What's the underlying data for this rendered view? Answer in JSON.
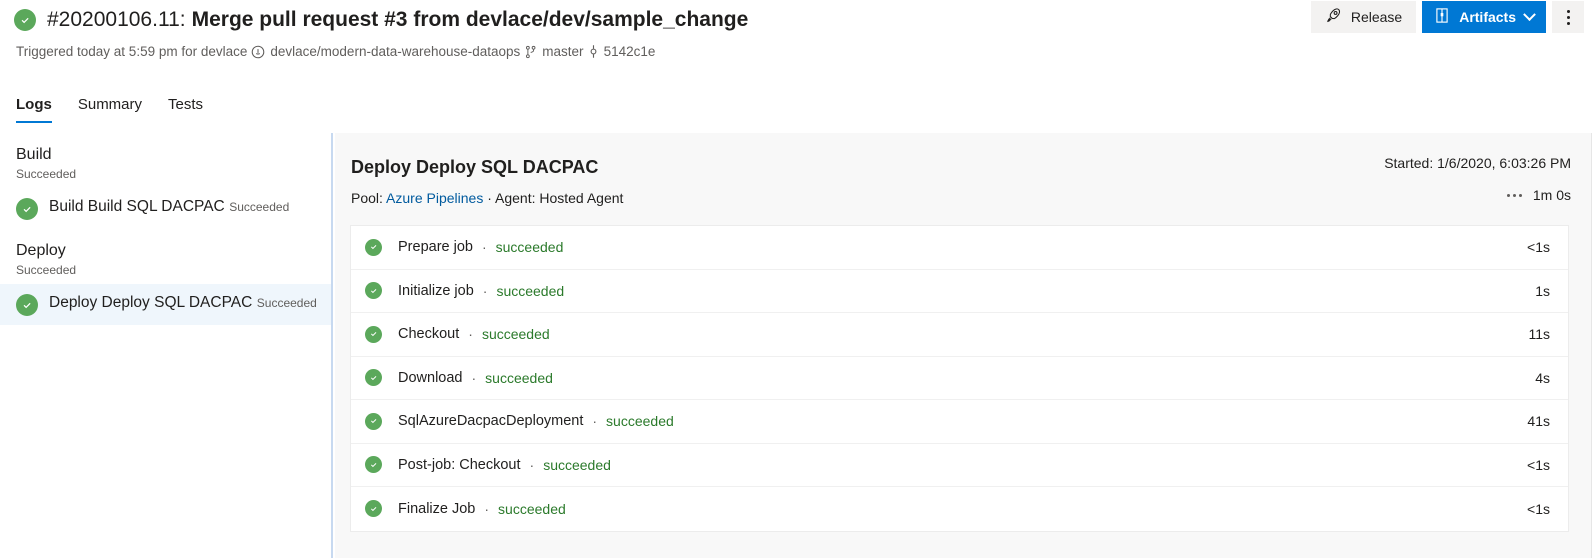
{
  "header": {
    "status_icon": "check-circle-icon",
    "build_number": "#20200106.11:",
    "build_title": "Merge pull request #3 from devlace/dev/sample_change",
    "triggered_text": "Triggered today at 5:59 pm for devlace",
    "repo_icon": "github-icon",
    "repo": "devlace/modern-data-warehouse-dataops",
    "branch_icon": "branch-icon",
    "branch": "master",
    "commit_icon": "commit-icon",
    "commit": "5142c1e",
    "actions": {
      "release_label": "Release",
      "release_icon": "rocket-icon",
      "artifacts_label": "Artifacts",
      "artifacts_icon": "package-icon",
      "artifacts_chevron": "chevron-down-icon",
      "more_icon": "kebab-menu-icon"
    }
  },
  "tabs": [
    {
      "label": "Logs",
      "active": true
    },
    {
      "label": "Summary",
      "active": false
    },
    {
      "label": "Tests",
      "active": false
    }
  ],
  "sidebar": {
    "stages": [
      {
        "name": "Build",
        "status": "Succeeded",
        "jobs": [
          {
            "name": "Build Build SQL DACPAC",
            "status": "Succeeded",
            "selected": false,
            "icon": "check-circle-icon"
          }
        ]
      },
      {
        "name": "Deploy",
        "status": "Succeeded",
        "jobs": [
          {
            "name": "Deploy Deploy SQL DACPAC",
            "status": "Succeeded",
            "selected": true,
            "icon": "check-circle-icon"
          }
        ]
      }
    ]
  },
  "panel": {
    "title": "Deploy Deploy SQL DACPAC",
    "pool_label": "Pool:",
    "pool_link": "Azure Pipelines",
    "agent_text": "· Agent: Hosted Agent",
    "started": "Started: 1/6/2020, 6:03:26 PM",
    "duration": "1m 0s",
    "more_icon": "ellipsis-icon",
    "tasks": [
      {
        "icon": "check-circle-icon",
        "name": "Prepare job",
        "separator": "·",
        "result": "succeeded",
        "duration": "<1s"
      },
      {
        "icon": "check-circle-icon",
        "name": "Initialize job",
        "separator": "·",
        "result": "succeeded",
        "duration": "1s"
      },
      {
        "icon": "check-circle-icon",
        "name": "Checkout",
        "separator": "·",
        "result": "succeeded",
        "duration": "11s"
      },
      {
        "icon": "check-circle-icon",
        "name": "Download",
        "separator": "·",
        "result": "succeeded",
        "duration": "4s"
      },
      {
        "icon": "check-circle-icon",
        "name": "SqlAzureDacpacDeployment",
        "separator": "·",
        "result": "succeeded",
        "duration": "41s"
      },
      {
        "icon": "check-circle-icon",
        "name": "Post-job: Checkout",
        "separator": "·",
        "result": "succeeded",
        "duration": "<1s"
      },
      {
        "icon": "check-circle-icon",
        "name": "Finalize Job",
        "separator": "·",
        "result": "succeeded",
        "duration": "<1s"
      }
    ]
  },
  "colors": {
    "accent": "#0078d4",
    "success": "#5ba85b",
    "success_text": "#2b7a2b",
    "link": "#005a9e",
    "selected_row": "#eff6fc",
    "panel_bg": "#f8f8f8"
  }
}
